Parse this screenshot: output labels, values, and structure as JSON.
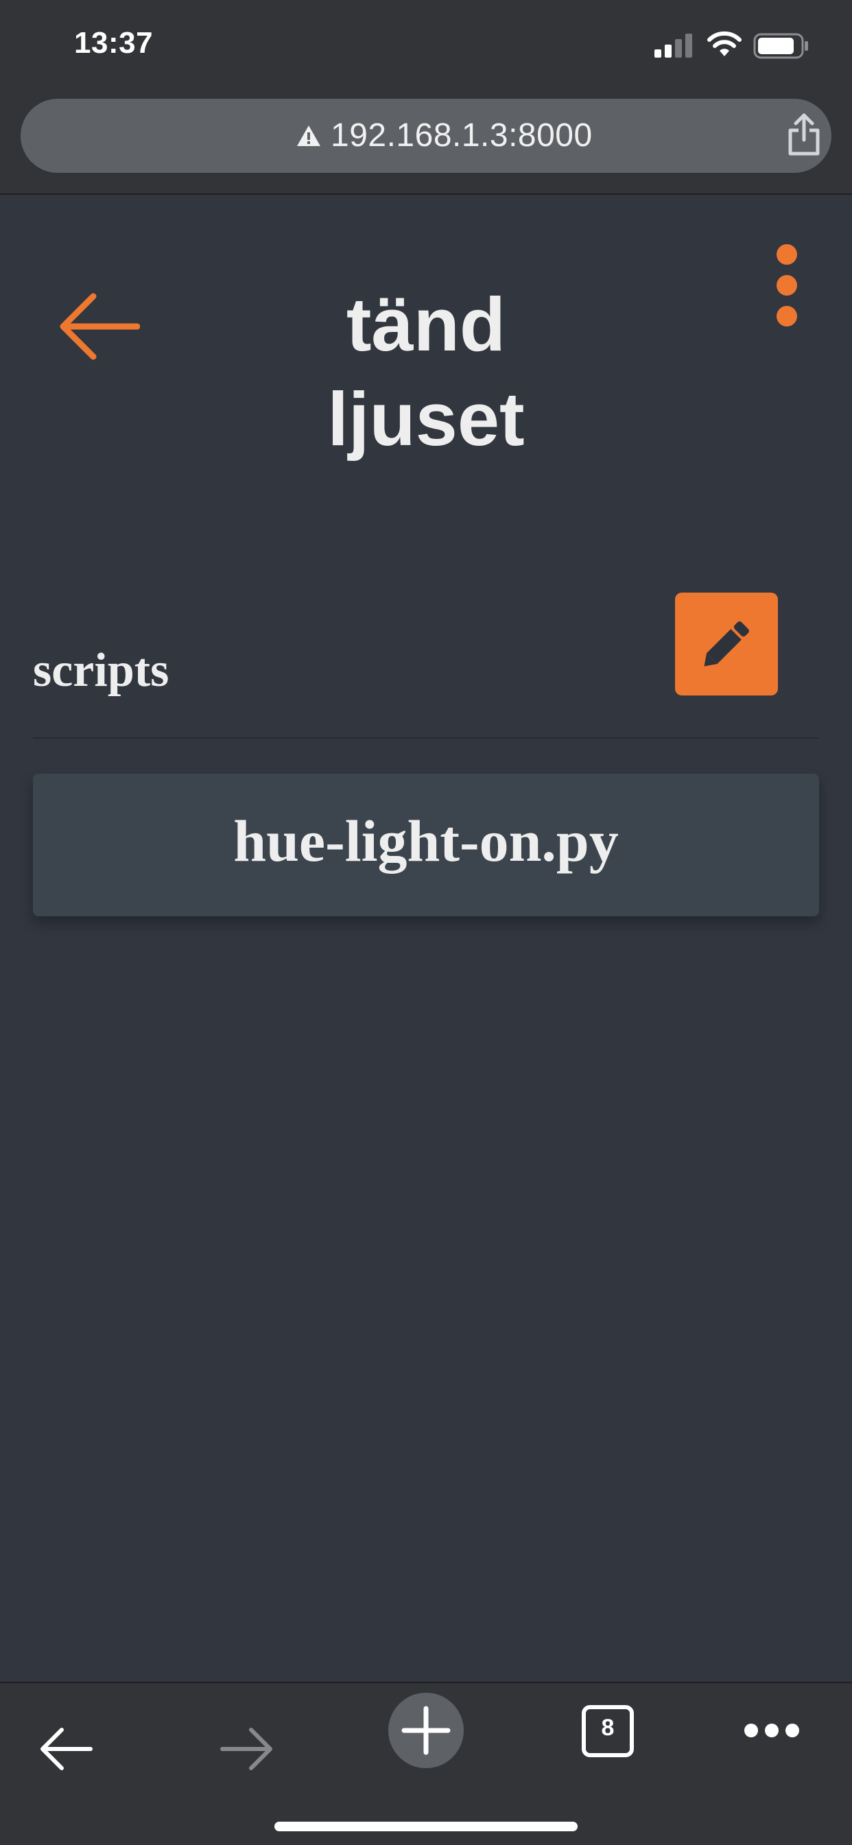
{
  "status_bar": {
    "time": "13:37",
    "signal_icon": "cellular-signal-icon",
    "wifi_icon": "wifi-icon",
    "battery_icon": "battery-icon"
  },
  "browser": {
    "url": "192.168.1.3:8000",
    "security_icon": "warning-triangle-icon",
    "share_icon": "share-icon"
  },
  "header": {
    "title_line1": "tänd",
    "title_line2": "ljuset",
    "back_icon": "arrow-left-icon",
    "menu_icon": "vertical-dots-icon"
  },
  "scripts_section": {
    "label": "scripts",
    "edit_icon": "pencil-icon",
    "items": [
      {
        "name": "hue-light-on.py"
      }
    ]
  },
  "toolbar": {
    "back_icon": "arrow-left-icon",
    "forward_icon": "arrow-right-icon",
    "new_tab_icon": "plus-icon",
    "tab_count": "8",
    "more_icon": "horizontal-dots-icon"
  },
  "colors": {
    "background": "#31363f",
    "accent": "#ef7831",
    "card": "#3c444d",
    "browser_chrome": "#333437"
  }
}
